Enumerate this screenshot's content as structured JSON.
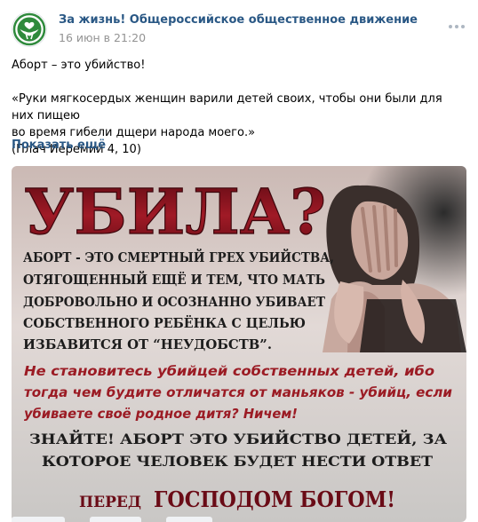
{
  "post": {
    "author": "За жизнь! Общероссийское общественное движение",
    "date": "16 июн в 21:20",
    "text_line1": "Аборт – это убийство!",
    "quote_line1": "«Руки мягкосердых женщин варили детей своих, чтобы они были для них пищею",
    "quote_line2": "во время гибели дщери народа моего.»",
    "reference": "(Плач Иеремии 4, 10)",
    "show_more": "Показать ещё",
    "more_icon": "more-horizontal-icon",
    "logo_icon": "hands-heart-logo-icon"
  },
  "image": {
    "headline": "УБИЛА?",
    "block1": [
      "АБОРТ - ЭТО СМЕРТНЫЙ ГРЕХ УБИЙСТВА,",
      "ОТЯГОЩЕННЫЙ ЕЩЁ И ТЕМ, ЧТО МАТЬ",
      "ДОБРОВОЛЬНО И ОСОЗНАННО УБИВАЕТ",
      "СОБСТВЕННОГО РЕБЁНКА С ЦЕЛЬЮ",
      "ИЗБАВИТСЯ ОТ “НЕУДОБСТВ”."
    ],
    "block2": [
      "Не становитесь убийцей собственных детей, ибо",
      "тогда чем будите отличатся от маньяков - убийц, если",
      "убиваете своё родное дитя? Ничем!"
    ],
    "block3": [
      "ЗНАЙТЕ! АБОРТ ЭТО УБИЙСТВО ДЕТЕЙ, ЗА",
      "КОТОРОЕ ЧЕЛОВЕК БУДЕТ НЕСТИ ОТВЕТ"
    ],
    "footer_prefix": "ПЕРЕД",
    "footer_main": "ГОСПОДОМ БОГОМ!",
    "colors": {
      "headline": "#8e1420",
      "block1": "#1c1c1c",
      "block2": "#9b1b24",
      "accent_link": "#2a5885"
    }
  }
}
